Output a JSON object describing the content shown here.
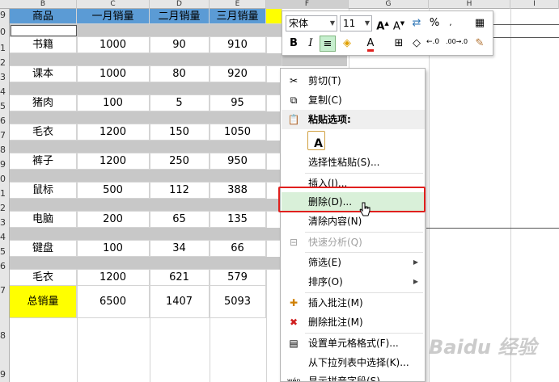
{
  "sheet": {
    "columns": [
      "B",
      "C",
      "D",
      "E",
      "F",
      "G",
      "H",
      "I"
    ],
    "row_numbers": [
      "9",
      "0",
      "1",
      "2",
      "3",
      "4",
      "5",
      "6",
      "7",
      "8",
      "9",
      "0",
      "1",
      "2",
      "3",
      "4",
      "5",
      "6",
      "7",
      "8",
      "9"
    ],
    "header_row": [
      "商品",
      "一月销量",
      "二月销量",
      "三月销量"
    ],
    "rows": [
      {
        "item": "书籍",
        "jan": "1000",
        "feb": "90",
        "mar": "910"
      },
      {
        "item": "课本",
        "jan": "1000",
        "feb": "80",
        "mar": "920"
      },
      {
        "item": "猪肉",
        "jan": "100",
        "feb": "5",
        "mar": "95"
      },
      {
        "item": "毛衣",
        "jan": "1200",
        "feb": "150",
        "mar": "1050"
      },
      {
        "item": "裤子",
        "jan": "1200",
        "feb": "250",
        "mar": "950"
      },
      {
        "item": "鼠标",
        "jan": "500",
        "feb": "112",
        "mar": "388"
      },
      {
        "item": "电脑",
        "jan": "200",
        "feb": "65",
        "mar": "135"
      },
      {
        "item": "键盘",
        "jan": "100",
        "feb": "34",
        "mar": "66"
      },
      {
        "item": "毛衣",
        "jan": "1200",
        "feb": "621",
        "mar": "579"
      }
    ],
    "total": {
      "item": "总销量",
      "jan": "6500",
      "feb": "1407",
      "mar": "5093"
    }
  },
  "minibar": {
    "font_name": "宋体",
    "font_size": "11",
    "bold": "B",
    "italic": "I",
    "font_color_letter": "A",
    "percent": "%",
    "dec_more": "←.0",
    "dec_less": ".00→.0"
  },
  "menu": {
    "cut": "剪切(T)",
    "copy": "复制(C)",
    "paste_options": "粘贴选项:",
    "paste_special": "选择性粘贴(S)...",
    "insert": "插入(I)...",
    "delete": "删除(D)...",
    "clear": "清除内容(N)",
    "quick_analysis": "快速分析(Q)",
    "filter": "筛选(E)",
    "sort": "排序(O)",
    "insert_comment": "插入批注(M)",
    "delete_comment": "删除批注(M)",
    "format_cells": "设置单元格格式(F)...",
    "pick_list": "从下拉列表中选择(K)...",
    "phonetic": "显示拼音字段(S)"
  },
  "colors": {
    "header_blue": "#5b9bd5",
    "gray_band": "#c8c8c8",
    "highlight_yellow": "#ffff00",
    "menu_highlight": "#d9f0d9",
    "callout_red": "#e0201e"
  },
  "watermark": "Baidu 经验"
}
